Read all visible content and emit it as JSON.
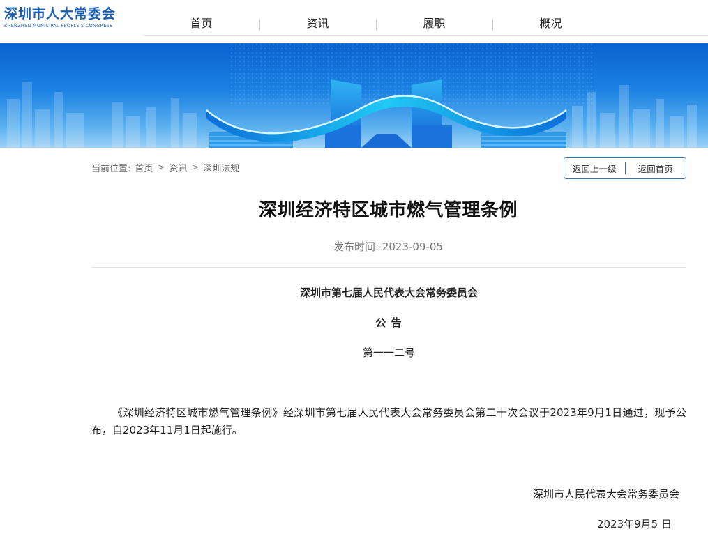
{
  "header": {
    "logo_cn": "深圳市人大常委会",
    "logo_en": "SHENZHEN MUNICIPAL PEOPLE'S CONGRESS",
    "nav": [
      {
        "label": "首页"
      },
      {
        "label": "资讯"
      },
      {
        "label": "履职"
      },
      {
        "label": "概况"
      }
    ]
  },
  "breadcrumb": {
    "prefix": "当前位置:",
    "items": [
      "首页",
      "资讯",
      "深圳法规"
    ],
    "separator": ">"
  },
  "actions": {
    "back_up": "返回上一级",
    "back_home": "返回首页"
  },
  "article": {
    "title": "深圳经济特区城市燃气管理条例",
    "published": "发布时间: 2023-09-05",
    "issuer": "深圳市第七届人民代表大会常务委员会",
    "notice_heading": "公  告",
    "notice_number": "第一一二号",
    "body": "《深圳经济特区城市燃气管理条例》经深圳市第七届人民代表大会常务委员会第二十次会议于2023年9月1日通过，现予公布，自2023年11月1日起施行。",
    "signature": "深圳市人民代表大会常务委员会",
    "date": "2023年9月5 日"
  },
  "colors": {
    "brand": "#1a5fb4",
    "banner_top": "#0a63d1",
    "banner_bottom": "#9bd0f5",
    "button_border": "#3a6fb0"
  }
}
